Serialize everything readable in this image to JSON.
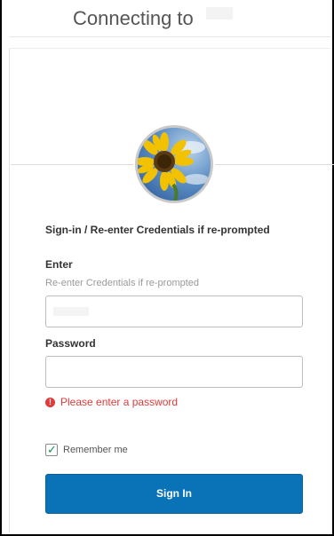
{
  "window": {
    "title": "Connecting to"
  },
  "login": {
    "heading": "Sign-in / Re-enter Credentials if re-prompted",
    "username_label": "Enter",
    "username_hint": "Re-enter Credentials if re-prompted",
    "username_value": "",
    "password_label": "Password",
    "password_value": "",
    "error_message": "Please enter a password",
    "error_icon": "exclamation-circle-icon",
    "remember_label": "Remember me",
    "remember_checked": true,
    "signin_label": "Sign In"
  },
  "colors": {
    "primary_button": "#0a73b8",
    "error": "#e03a3a",
    "check": "#1a8f4a"
  }
}
